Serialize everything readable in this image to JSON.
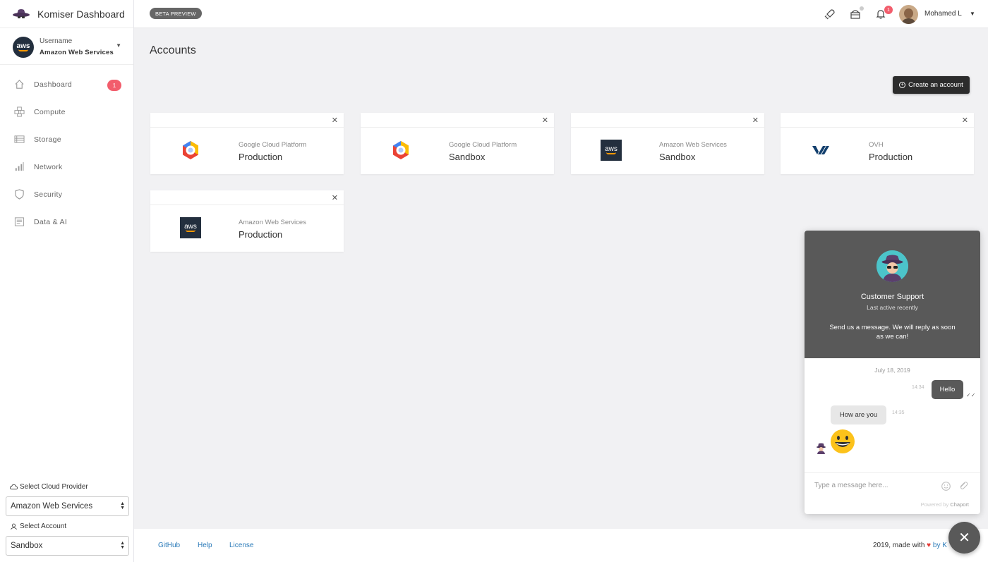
{
  "brand": {
    "title": "Komiser Dashboard"
  },
  "user": {
    "label": "Username",
    "provider": "Amazon Web Services",
    "logo_text": "aws"
  },
  "nav": [
    {
      "label": "Dashboard",
      "icon": "home-icon",
      "badge": "1"
    },
    {
      "label": "Compute",
      "icon": "compute-icon"
    },
    {
      "label": "Storage",
      "icon": "storage-icon"
    },
    {
      "label": "Network",
      "icon": "network-icon"
    },
    {
      "label": "Security",
      "icon": "shield-icon"
    },
    {
      "label": "Data & AI",
      "icon": "data-icon"
    }
  ],
  "selectors": {
    "provider_label": "Select Cloud Provider",
    "provider_value": "Amazon Web Services",
    "account_label": "Select Account",
    "account_value": "Sandbox"
  },
  "topbar": {
    "beta": "BETA PREVIEW",
    "bell_count": "1",
    "username": "Mohamed L"
  },
  "main": {
    "title": "Accounts",
    "create_button": "Create an account",
    "accounts": [
      {
        "provider": "Google Cloud Platform",
        "env": "Production",
        "logo": "gcp-icon"
      },
      {
        "provider": "Google Cloud Platform",
        "env": "Sandbox",
        "logo": "gcp-icon"
      },
      {
        "provider": "Amazon Web Services",
        "env": "Sandbox",
        "logo": "aws-icon"
      },
      {
        "provider": "OVH",
        "env": "Production",
        "logo": "ovh-icon"
      },
      {
        "provider": "Amazon Web Services",
        "env": "Production",
        "logo": "aws-icon"
      }
    ]
  },
  "footer": {
    "links": [
      "GitHub",
      "Help",
      "License"
    ],
    "credit_prefix": "2019, made with",
    "credit_suffix": "by K"
  },
  "chat": {
    "title": "Customer Support",
    "subtitle": "Last active recently",
    "intro": "Send us a message. We will reply as soon as we can!",
    "date": "July 18, 2019",
    "messages": [
      {
        "text": "Hello",
        "time": "14:34",
        "from": "user"
      },
      {
        "text": "How are you",
        "time": "14:35",
        "from": "agent"
      }
    ],
    "input_placeholder": "Type a message here...",
    "powered_prefix": "Powered by",
    "powered_brand": "Chaport"
  },
  "colors": {
    "accent": "#f25d6c",
    "dark": "#595959",
    "link": "#2b7bb9"
  }
}
